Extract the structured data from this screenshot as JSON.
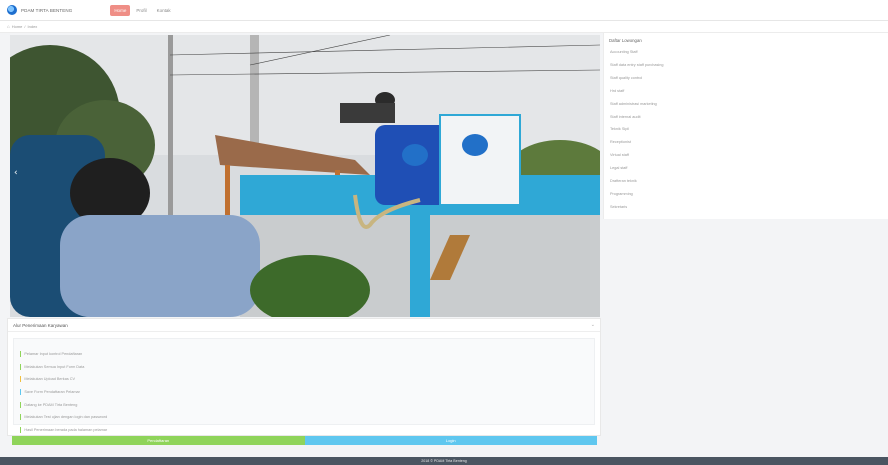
{
  "navbar": {
    "brand": "PDAM TIRTA BENTENG",
    "items": [
      {
        "label": "Home",
        "active": true
      },
      {
        "label": "Profil",
        "active": false
      },
      {
        "label": "Kontak",
        "active": false
      }
    ]
  },
  "breadcrumb": [
    "Home",
    "Index"
  ],
  "steps": {
    "title": "Alur Penerimaan Karyawan",
    "items": [
      {
        "text": "Pelamar Input kontrol Pendaftaran",
        "color": "#8fd45a"
      },
      {
        "text": "Melakukan Semua Input Form Data",
        "color": "#8fd45a"
      },
      {
        "text": "Melakukan Upload Berkas CV",
        "color": "#f0c040"
      },
      {
        "text": "Save Form Pendaftaran Pelamar",
        "color": "#5fc7ef"
      },
      {
        "text": "Datang ke PDAM Tirta Benteng",
        "color": "#8fd45a"
      },
      {
        "text": "Melakukan Test ujian dengan login dan password",
        "color": "#8fd45a"
      },
      {
        "text": "Hasil Penerimaan berada pada halaman pelamar",
        "color": "#8fd45a"
      }
    ]
  },
  "buttons": {
    "register": "Pendaftaran",
    "login": "Login"
  },
  "sidebar": {
    "title": "Daftar Lowongan",
    "items": [
      "Accounting Staff",
      "Staff data entry staff purchasing",
      "Staff quality control",
      "Hrd staff",
      "Staff administrasi marketing",
      "Staff internal audit",
      "Teknik Sipil",
      "Receptionist",
      "Virtual staff",
      "Legal staff",
      "Drafteran teknik",
      "Programming",
      "Sekretaris"
    ]
  },
  "footer": "2018 © PDAM Tirta Benteng",
  "colors": {
    "nav_active": "#ef8e86",
    "register": "#8fd45a",
    "login": "#5fc7ef",
    "footer": "#4a5561"
  }
}
